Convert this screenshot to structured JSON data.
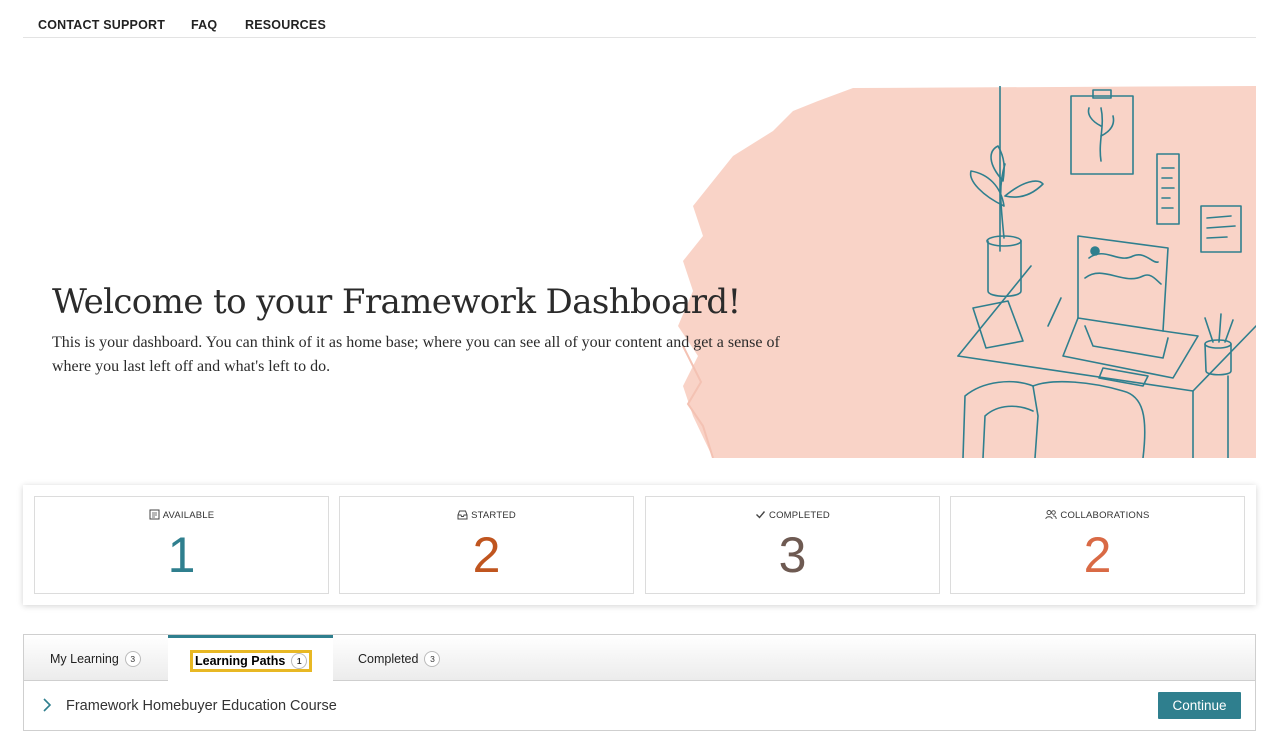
{
  "nav": {
    "items": [
      {
        "label": "CONTACT SUPPORT"
      },
      {
        "label": "FAQ"
      },
      {
        "label": "RESOURCES"
      }
    ]
  },
  "hero": {
    "title": "Welcome to your Framework Dashboard!",
    "description": "This is your dashboard. You can think of it as home base; where you can see all of your content and get a sense of where you last left off and what's left to do."
  },
  "stats": [
    {
      "label": "AVAILABLE",
      "value": "1",
      "color": "#2f7f8e",
      "icon": "book-icon"
    },
    {
      "label": "STARTED",
      "value": "2",
      "color": "#c0551f",
      "icon": "inbox-icon"
    },
    {
      "label": "COMPLETED",
      "value": "3",
      "color": "#6e5a52",
      "icon": "check-icon"
    },
    {
      "label": "COLLABORATIONS",
      "value": "2",
      "color": "#d96a45",
      "icon": "users-icon"
    }
  ],
  "tabs": [
    {
      "label": "My Learning",
      "count": "3"
    },
    {
      "label": "Learning Paths",
      "count": "1",
      "active": true
    },
    {
      "label": "Completed",
      "count": "3"
    }
  ],
  "content": {
    "items": [
      {
        "title": "Framework Homebuyer Education Course",
        "action": "Continue"
      }
    ]
  },
  "colors": {
    "accent": "#2f7f8e",
    "hero_blush": "#f9d3c7"
  }
}
